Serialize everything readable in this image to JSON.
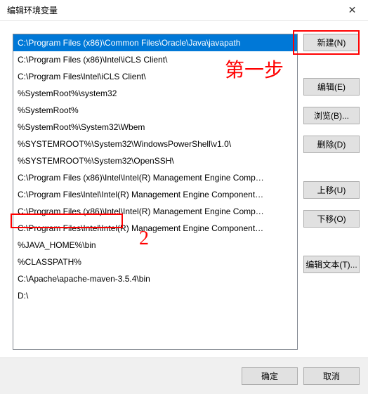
{
  "window": {
    "title": "编辑环境变量"
  },
  "list": {
    "items": [
      "C:\\Program Files (x86)\\Common Files\\Oracle\\Java\\javapath",
      "C:\\Program Files (x86)\\Intel\\iCLS Client\\",
      "C:\\Program Files\\Intel\\iCLS Client\\",
      "%SystemRoot%\\system32",
      "%SystemRoot%",
      "%SystemRoot%\\System32\\Wbem",
      "%SYSTEMROOT%\\System32\\WindowsPowerShell\\v1.0\\",
      "%SYSTEMROOT%\\System32\\OpenSSH\\",
      "C:\\Program Files (x86)\\Intel\\Intel(R) Management Engine Comp…",
      "C:\\Program Files\\Intel\\Intel(R) Management Engine Component…",
      "C:\\Program Files (x86)\\Intel\\Intel(R) Management Engine Comp…",
      "C:\\Program Files\\Intel\\Intel(R) Management Engine Component…",
      "%JAVA_HOME%\\bin",
      "%CLASSPATH%",
      "C:\\Apache\\apache-maven-3.5.4\\bin",
      "D:\\"
    ],
    "selected_index": 0
  },
  "buttons": {
    "new": "新建(N)",
    "edit": "编辑(E)",
    "browse": "浏览(B)...",
    "delete": "删除(D)",
    "move_up": "上移(U)",
    "move_down": "下移(O)",
    "edit_text": "编辑文本(T)...",
    "ok": "确定",
    "cancel": "取消"
  },
  "annotations": {
    "step1": "第一步",
    "num2": "2"
  }
}
